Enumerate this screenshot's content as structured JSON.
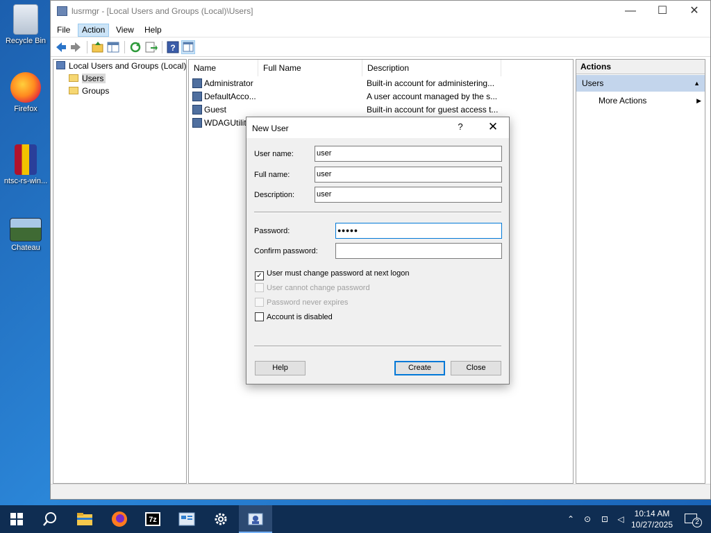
{
  "desktop": {
    "icons": [
      {
        "label": "Recycle Bin",
        "icon": "recycle-bin-icon"
      },
      {
        "label": "Firefox",
        "icon": "firefox-icon"
      },
      {
        "label": "ntsc-rs-win...",
        "icon": "winrar-archive-icon"
      },
      {
        "label": "Chateau",
        "icon": "image-file-icon"
      }
    ]
  },
  "window": {
    "title": "lusrmgr - [Local Users and Groups (Local)\\Users]",
    "controls": {
      "minimize": "—",
      "maximize": "☐",
      "close": "✕"
    }
  },
  "menubar": {
    "items": [
      "File",
      "Action",
      "View",
      "Help"
    ],
    "active": "Action"
  },
  "tree": {
    "root": "Local Users and Groups (Local)",
    "children": [
      "Users",
      "Groups"
    ],
    "selected": "Users"
  },
  "list": {
    "columns": [
      "Name",
      "Full Name",
      "Description"
    ],
    "rows": [
      {
        "name": "Administrator",
        "full_name": "",
        "description": "Built-in account for administering..."
      },
      {
        "name": "DefaultAcco...",
        "full_name": "",
        "description": "A user account managed by the s..."
      },
      {
        "name": "Guest",
        "full_name": "",
        "description": "Built-in account for guest access t..."
      },
      {
        "name": "WDAGUtilit",
        "full_name": "",
        "description": ""
      }
    ]
  },
  "actions": {
    "header": "Actions",
    "group": "Users",
    "items": [
      "More Actions"
    ]
  },
  "dialog": {
    "title": "New User",
    "help_glyph": "?",
    "close_glyph": "✕",
    "fields": {
      "username": {
        "label": "User name:",
        "value": "user"
      },
      "fullname": {
        "label": "Full name:",
        "value": "user"
      },
      "description": {
        "label": "Description:",
        "value": "user"
      },
      "password": {
        "label": "Password:",
        "value": "●●●●●"
      },
      "confirm": {
        "label": "Confirm password:",
        "value": ""
      }
    },
    "checkboxes": [
      {
        "label": "User must change password at next logon",
        "checked": true,
        "enabled": true
      },
      {
        "label": "User cannot change password",
        "checked": false,
        "enabled": false
      },
      {
        "label": "Password never expires",
        "checked": false,
        "enabled": false
      },
      {
        "label": "Account is disabled",
        "checked": false,
        "enabled": true
      }
    ],
    "buttons": {
      "help": "Help",
      "create": "Create",
      "close": "Close"
    }
  },
  "taskbar": {
    "pinned": [
      "start-icon",
      "search-icon",
      "file-explorer-icon",
      "firefox-icon",
      "7zip-icon",
      "control-panel-icon",
      "settings-icon",
      "lusrmgr-icon"
    ],
    "clock": {
      "time": "10:14 AM",
      "date": "10/27/2025"
    },
    "notification_count": "2"
  },
  "colors": {
    "accent": "#0078d7",
    "taskbar": "#0f2d52",
    "actions_group": "#c3d5ec"
  }
}
